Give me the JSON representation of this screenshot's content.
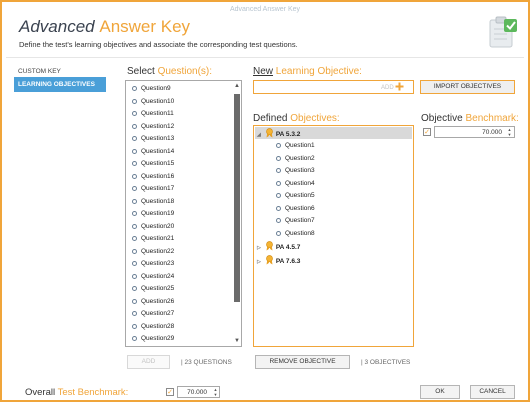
{
  "window": {
    "title": "Advanced Answer Key"
  },
  "header": {
    "title_main": "Advanced",
    "title_accent": "Answer Key",
    "subtitle": "Define the test's learning objectives and associate the corresponding test questions."
  },
  "sidebar": {
    "items": [
      {
        "label": "CUSTOM KEY",
        "active": false
      },
      {
        "label": "LEARNING OBJECTIVES",
        "active": true
      }
    ]
  },
  "questions_panel": {
    "label_main": "Select",
    "label_accent": "Question(s):",
    "items": [
      "Question9",
      "Question10",
      "Question11",
      "Question12",
      "Question13",
      "Question14",
      "Question15",
      "Question16",
      "Question17",
      "Question18",
      "Question19",
      "Question20",
      "Question21",
      "Question22",
      "Question23",
      "Question24",
      "Question25",
      "Question26",
      "Question27",
      "Question28",
      "Question29"
    ],
    "add_label": "ADD",
    "count_text": "| 23 QUESTIONS"
  },
  "new_objective": {
    "label_main": "New",
    "label_accent": "Learning Objective:",
    "add_label": "ADD",
    "import_label": "IMPORT OBJECTIVES"
  },
  "defined_objectives": {
    "label_main": "Defined",
    "label_accent": "Objectives:",
    "objectives": [
      {
        "name": "PA 5.3.2",
        "expanded": true,
        "questions": [
          "Question1",
          "Question2",
          "Question3",
          "Question4",
          "Question5",
          "Question6",
          "Question7",
          "Question8"
        ]
      },
      {
        "name": "PA 4.5.7",
        "expanded": false,
        "questions": []
      },
      {
        "name": "PA 7.6.3",
        "expanded": false,
        "questions": []
      }
    ],
    "remove_label": "REMOVE OBJECTIVE",
    "count_text": "| 3 OBJECTIVES"
  },
  "objective_benchmark": {
    "label_main": "Objective",
    "label_accent": "Benchmark:",
    "checked": true,
    "value": "70.000"
  },
  "footer": {
    "label_main": "Overall",
    "label_accent": "Test Benchmark:",
    "checked": true,
    "value": "70.000",
    "ok_label": "OK",
    "cancel_label": "CANCEL"
  },
  "colors": {
    "accent": "#f0a53a",
    "sidebar_active": "#4a9fd8",
    "icon_green": "#5cb85c"
  },
  "icons": [
    "clipboard-check-icon",
    "question-bullet-icon",
    "plus-icon",
    "ribbon-icon",
    "scroll-up-icon",
    "scroll-down-icon",
    "spin-up-icon",
    "spin-down-icon",
    "expander-icon"
  ]
}
